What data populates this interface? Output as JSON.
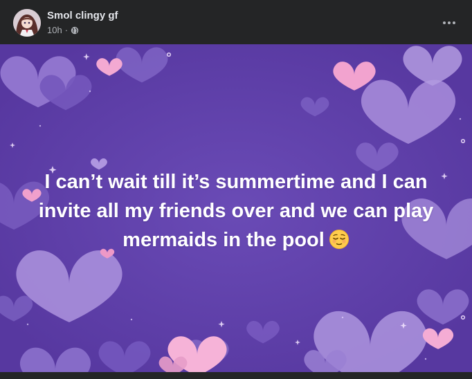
{
  "post": {
    "author": "Smol clingy gf",
    "timestamp": "10h",
    "separator": "·",
    "audience_icon": "globe-icon",
    "menu_icon": "more-horizontal-icon",
    "text_lines": [
      "I can’t wait till it’s summertime and I can",
      "invite all my friends over and we can play",
      "mermaids in the pool"
    ],
    "emoji": "relieved-face-emoji",
    "background": {
      "base_color": "#5f41a8",
      "theme": "purple and pink hearts"
    }
  },
  "colors": {
    "card_bg": "#242526",
    "primary_text": "#e4e6eb",
    "secondary_text": "#b0b3b8",
    "post_text": "#ffffff"
  }
}
